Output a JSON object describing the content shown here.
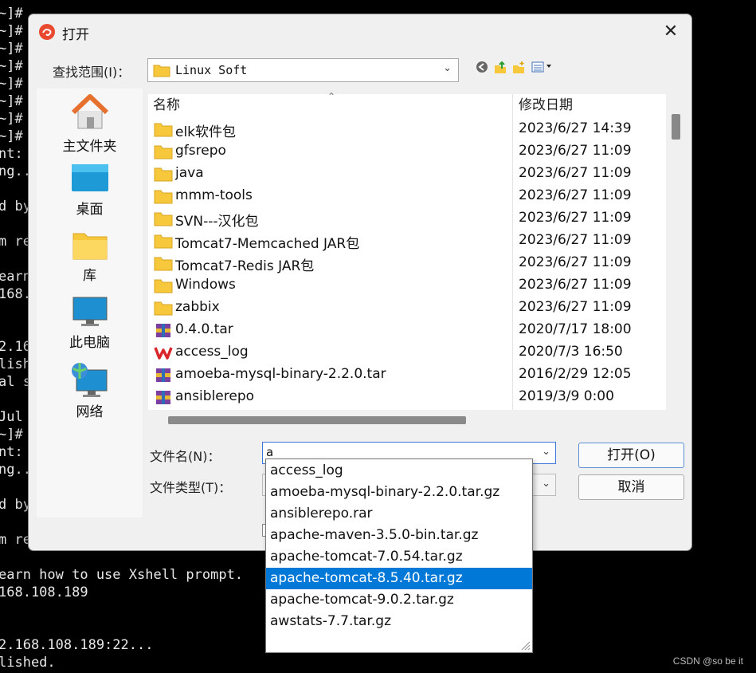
{
  "terminal": {
    "lines": [
      "~]#",
      "~]#",
      "~]#",
      "~]#",
      "~]#",
      "~]#",
      "~]#",
      "~]#",
      "nt:",
      "ng..",
      "d by",
      "m re",
      "earn",
      "168.",
      "2.16",
      "lish",
      "al s",
      "Jul",
      "~]#",
      "nt:",
      "ng..",
      "d by",
      "m re",
      "earn how to use Xshell prompt.",
      "168.108.189",
      "2.168.108.189:22...",
      "lished."
    ]
  },
  "watermark": "CSDN @so be it",
  "dialog": {
    "title": "打开",
    "close_glyph": "✕",
    "look_in_label": "查找范围(I)：",
    "look_in_value": "Linux Soft",
    "places": [
      {
        "label": "主文件夹",
        "icon": "home-icon"
      },
      {
        "label": "桌面",
        "icon": "desktop-icon"
      },
      {
        "label": "库",
        "icon": "library-icon"
      },
      {
        "label": "此电脑",
        "icon": "computer-icon"
      },
      {
        "label": "网络",
        "icon": "network-icon"
      }
    ],
    "columns": {
      "name": "名称",
      "date": "修改日期"
    },
    "files": [
      {
        "name": "elk软件包",
        "date": "2023/6/27 14:39",
        "type": "folder"
      },
      {
        "name": "gfsrepo",
        "date": "2023/6/27 11:09",
        "type": "folder"
      },
      {
        "name": "java",
        "date": "2023/6/27 11:09",
        "type": "folder"
      },
      {
        "name": "mmm-tools",
        "date": "2023/6/27 11:09",
        "type": "folder"
      },
      {
        "name": "SVN---汉化包",
        "date": "2023/6/27 11:09",
        "type": "folder"
      },
      {
        "name": "Tomcat7-Memcached JAR包",
        "date": "2023/6/27 11:09",
        "type": "folder"
      },
      {
        "name": "Tomcat7-Redis JAR包",
        "date": "2023/6/27 11:09",
        "type": "folder"
      },
      {
        "name": "Windows",
        "date": "2023/6/27 11:09",
        "type": "folder"
      },
      {
        "name": "zabbix",
        "date": "2023/6/27 11:09",
        "type": "folder"
      },
      {
        "name": "0.4.0.tar",
        "date": "2020/7/17 18:00",
        "type": "archive"
      },
      {
        "name": "access_log",
        "date": "2020/7/3 16:50",
        "type": "wps"
      },
      {
        "name": "amoeba-mysql-binary-2.2.0.tar",
        "date": "2016/2/29 12:05",
        "type": "archive"
      },
      {
        "name": "ansiblerepo",
        "date": "2019/3/9 0:00",
        "type": "archive"
      }
    ],
    "file_name_label": "文件名(N)：",
    "file_name_value": "a",
    "file_type_label": "文件类型(T)：",
    "open_button": "打开(O)",
    "cancel_button": "取消",
    "suggestions": [
      "access_log",
      "amoeba-mysql-binary-2.2.0.tar.gz",
      "ansiblerepo.rar",
      "apache-maven-3.5.0-bin.tar.gz",
      "apache-tomcat-7.0.54.tar.gz",
      "apache-tomcat-8.5.40.tar.gz",
      "apache-tomcat-9.0.2.tar.gz",
      "awstats-7.7.tar.gz"
    ],
    "selected_suggestion": "apache-tomcat-8.5.40.tar.gz"
  },
  "colors": {
    "selection": "#0078d7",
    "folder": "#f8c83c",
    "terminal_bg": "#000000"
  }
}
